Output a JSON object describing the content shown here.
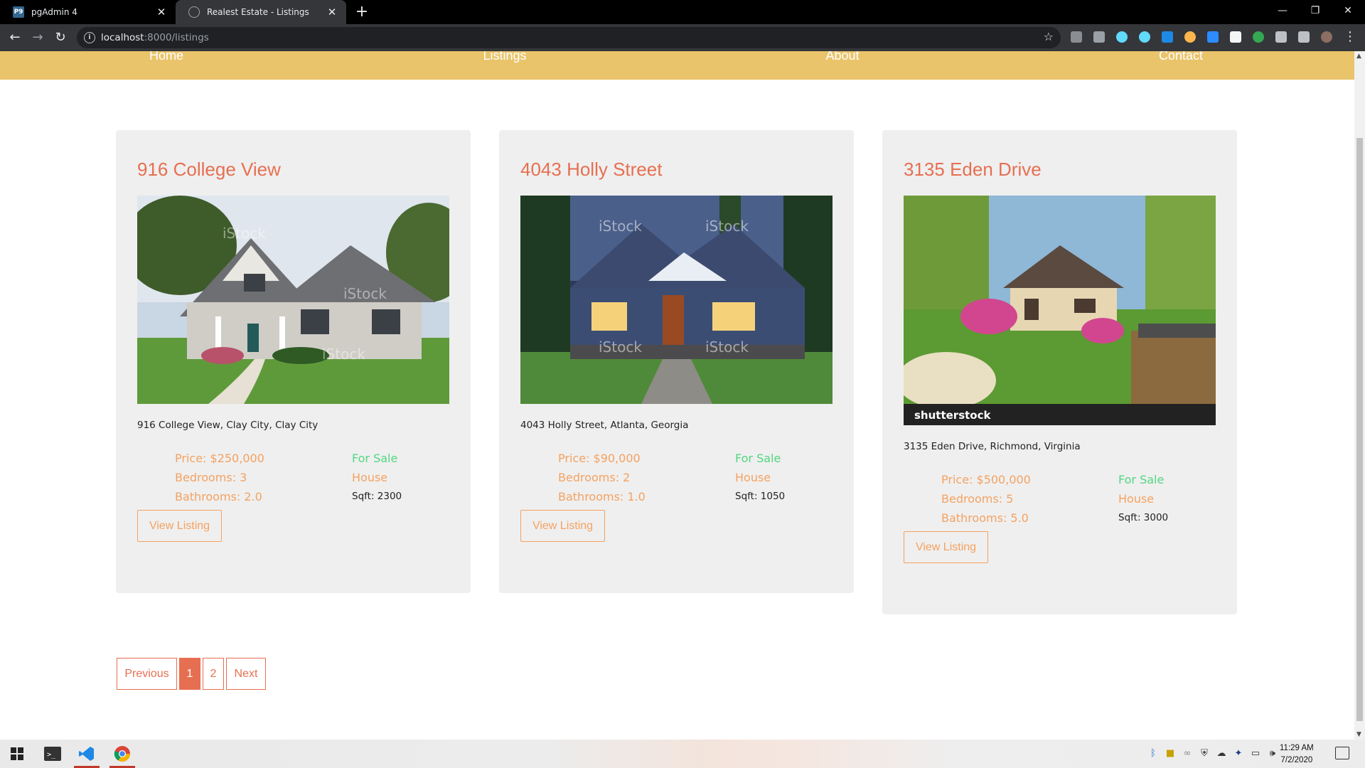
{
  "browser": {
    "tabs": [
      {
        "title": "pgAdmin 4",
        "favicon": "P9"
      },
      {
        "title": "Realest Estate - Listings"
      }
    ],
    "url_host": "localhost",
    "url_path": ":8000/listings"
  },
  "nav": {
    "links": [
      "Home",
      "Listings",
      "About",
      "Contact"
    ]
  },
  "listings": [
    {
      "title": "916 College View",
      "address": "916 College View, Clay City, Clay City",
      "price": "Price: $250,000",
      "bedrooms": "Bedrooms: 3",
      "bathrooms": "Bathrooms: 2.0",
      "sale_type": "For Sale",
      "home_type": "House",
      "sqft": "Sqft: 2300",
      "button": "View Listing",
      "image_watermark": "iStock"
    },
    {
      "title": "4043 Holly Street",
      "address": "4043 Holly Street, Atlanta, Georgia",
      "price": "Price: $90,000",
      "bedrooms": "Bedrooms: 2",
      "bathrooms": "Bathrooms: 1.0",
      "sale_type": "For Sale",
      "home_type": "House",
      "sqft": "Sqft: 1050",
      "button": "View Listing",
      "image_watermark": "iStock"
    },
    {
      "title": "3135 Eden Drive",
      "address": "3135 Eden Drive, Richmond, Virginia",
      "price": "Price: $500,000",
      "bedrooms": "Bedrooms: 5",
      "bathrooms": "Bathrooms: 5.0",
      "sale_type": "For Sale",
      "home_type": "House",
      "sqft": "Sqft: 3000",
      "button": "View Listing",
      "image_watermark": "shutterstock"
    }
  ],
  "pagination": {
    "previous": "Previous",
    "pages": [
      "1",
      "2"
    ],
    "active_page": "1",
    "next": "Next"
  },
  "taskbar": {
    "time": "11:29 AM",
    "date": "7/2/2020"
  },
  "colors": {
    "nav_bg": "#e9c46a",
    "title": "#e76f51",
    "detail": "#f4a261",
    "for_sale": "#52d681",
    "card_bg": "#efefef"
  }
}
